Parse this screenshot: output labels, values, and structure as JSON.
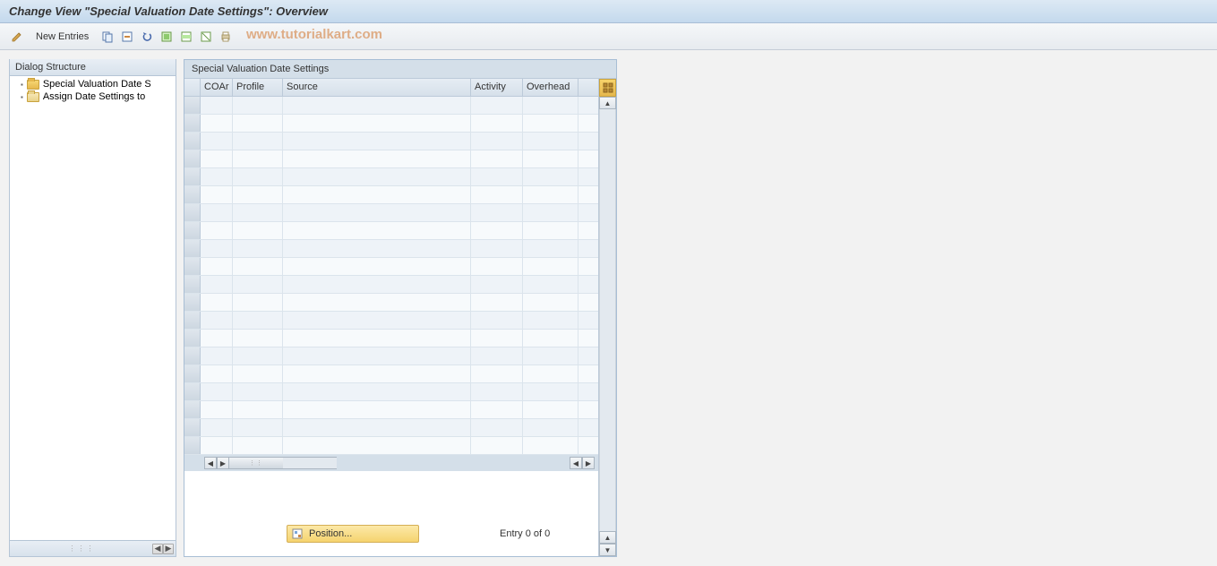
{
  "title": "Change View \"Special Valuation Date Settings\": Overview",
  "toolbar": {
    "new_entries_label": "New Entries"
  },
  "watermark": "www.tutorialkart.com",
  "dialog_structure": {
    "header": "Dialog Structure",
    "items": [
      {
        "label": "Special Valuation Date S",
        "open": true
      },
      {
        "label": "Assign Date Settings to",
        "open": false
      }
    ]
  },
  "table": {
    "title": "Special Valuation Date Settings",
    "columns": {
      "coar": "COAr",
      "profile": "Profile",
      "source": "Source",
      "activity": "Activity",
      "overhead": "Overhead"
    },
    "rows": 20
  },
  "footer": {
    "position_label": "Position...",
    "entry_status": "Entry 0 of 0"
  }
}
